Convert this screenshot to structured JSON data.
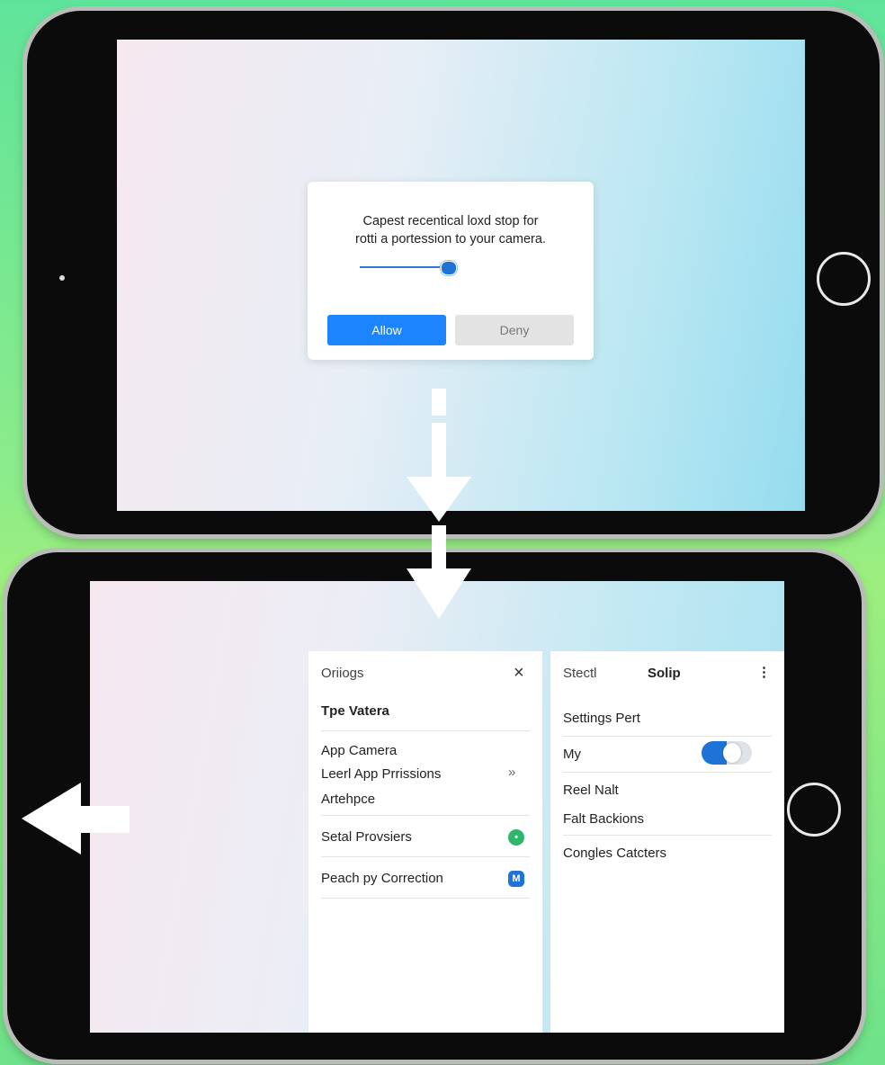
{
  "permission_dialog": {
    "message_line1": "Capest recentical loxd stop for",
    "message_line2": "rotti a portession to your camera.",
    "slider_level": 0.9,
    "allow_label": "Allow",
    "deny_label": "Deny"
  },
  "settings_panel": {
    "header_title": "Oriiogs",
    "close_icon": "×",
    "section_title": "Tpe Vatera",
    "items": [
      {
        "label": "App Camera"
      },
      {
        "label": "Leerl App Prrissions",
        "chevron": "»"
      },
      {
        "label": "Artehpce"
      },
      {
        "label": "Setal Provsiers",
        "badge_color": "#2fb66a",
        "badge_symbol": "•"
      },
      {
        "label": "Peach py Correction",
        "badge_color": "#1f73d6",
        "badge_symbol": "M"
      }
    ]
  },
  "side_panel": {
    "header_left": "Stectl",
    "header_center": "Solip",
    "more_icon": "⋮",
    "items": [
      {
        "label": "Settings Pert"
      },
      {
        "label": "My",
        "toggle_on": true
      },
      {
        "label": "Reel Nalt"
      },
      {
        "label": "Falt Backions"
      },
      {
        "label": "Congles Catcters"
      }
    ]
  },
  "colors": {
    "accent_blue": "#1d84ff",
    "background_green": "#8cec8a",
    "tablet_bezel": "#0b0b0b"
  }
}
